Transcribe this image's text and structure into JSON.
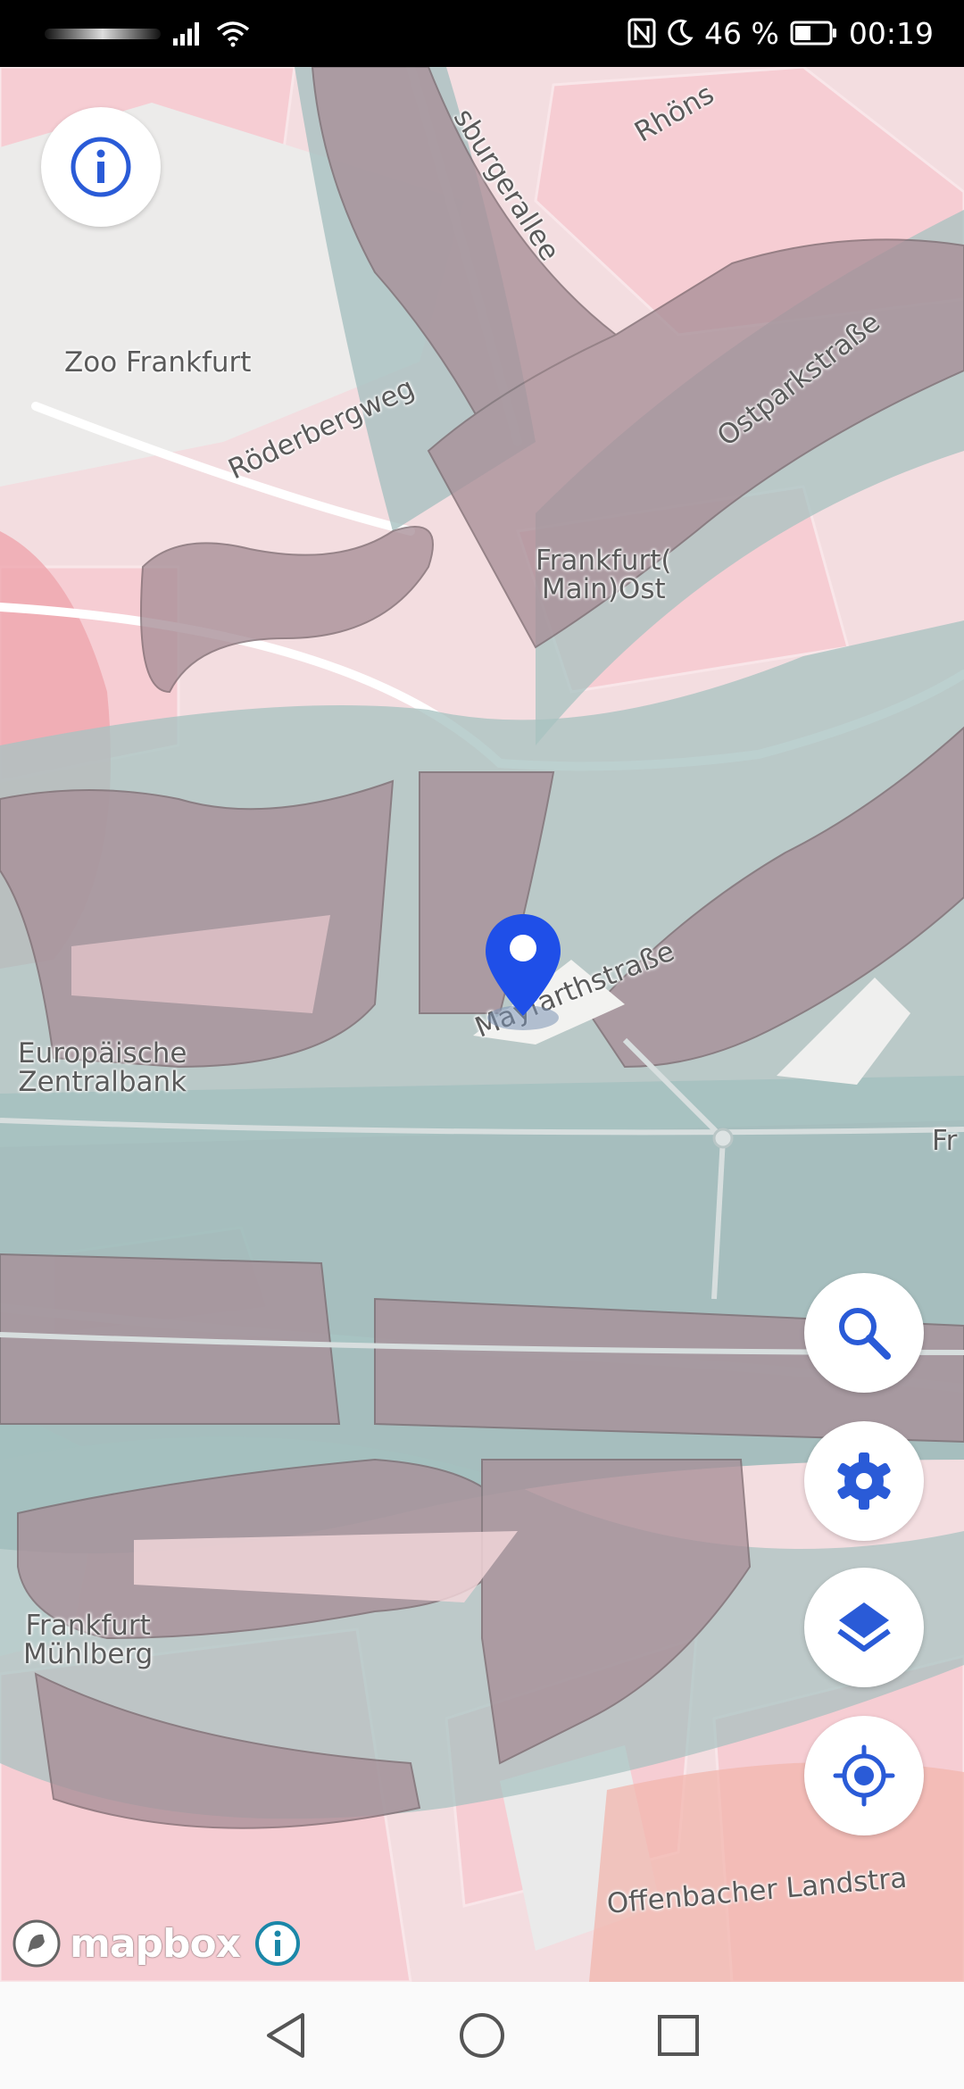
{
  "status_bar": {
    "battery_percent": "46 %",
    "time": "00:19",
    "icons": [
      "signal-icon",
      "wifi-icon",
      "nfc-icon",
      "moon-icon",
      "battery-icon"
    ]
  },
  "map": {
    "labels": {
      "zoo": "Zoo Frankfurt",
      "roederbergweg": "Röderbergweg",
      "ostparkstrasse": "Ostparkstraße",
      "burgerallee": "sburgerallee",
      "rhoens": "Rhöns",
      "station_ost": "Frankfurt(\nMain)Ost",
      "ezb": "Europäische\nZentralbank",
      "mayfarthstrasse": "Mayfarthstraße",
      "fr_edge": "Fr",
      "muehlberg": "Frankfurt\nMühlberg",
      "offenbacher": "Offenbacher Landstra"
    },
    "marker_icon": "location-pin-icon"
  },
  "controls": {
    "info_icon": "info-icon",
    "search_icon": "search-icon",
    "settings_icon": "gear-icon",
    "layers_icon": "layers-icon",
    "locate_icon": "crosshair-icon"
  },
  "attribution": {
    "brand": "mapbox"
  },
  "nav_bar": {
    "buttons": [
      "back-icon",
      "home-icon",
      "recents-icon"
    ]
  },
  "colors": {
    "accent_blue": "#2a5bd7",
    "marker_blue": "#1f4fe8",
    "water_overlay": "#9fbcbc",
    "building_overlay": "#a78e97",
    "pink_area": "#f4c9cf",
    "attribution_blue": "#1b87a8"
  }
}
